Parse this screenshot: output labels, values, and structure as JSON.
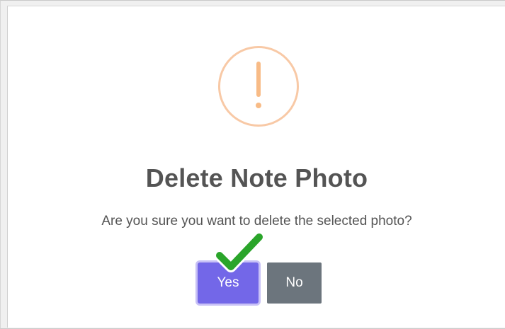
{
  "dialog": {
    "title": "Delete Note Photo",
    "message": "Are you sure you want to delete the selected photo?",
    "icon": "warning-exclamation-icon",
    "warning_color": "#f8bb86",
    "buttons": {
      "confirm_label": "Yes",
      "cancel_label": "No",
      "confirm_color": "#7367e8",
      "cancel_color": "#6c757d"
    }
  },
  "annotation": {
    "icon": "green-checkmark-icon",
    "color": "#2aa52a"
  }
}
